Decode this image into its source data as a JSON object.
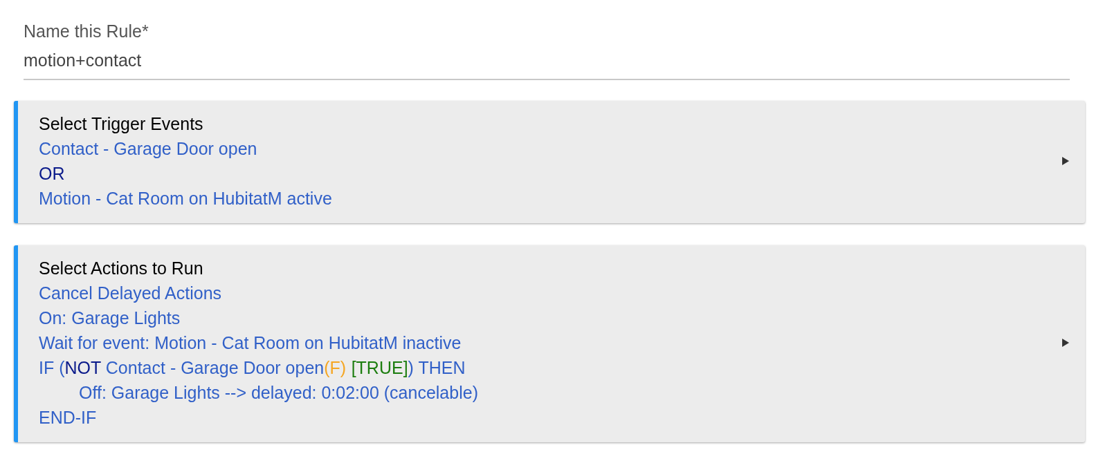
{
  "name_field": {
    "label": "Name this Rule*",
    "value": "motion+contact"
  },
  "sections": [
    {
      "title": "Select Trigger Events",
      "expanded": false,
      "lines": [
        {
          "segments": [
            {
              "kind": "link",
              "text": "Contact - Garage Door open"
            }
          ]
        },
        {
          "segments": [
            {
              "kind": "keyword",
              "text": "OR"
            }
          ]
        },
        {
          "segments": [
            {
              "kind": "link",
              "text": "Motion - Cat Room on HubitatM active"
            }
          ]
        }
      ]
    },
    {
      "title": "Select Actions to Run",
      "expanded": false,
      "lines": [
        {
          "segments": [
            {
              "kind": "link",
              "text": "Cancel Delayed Actions"
            }
          ]
        },
        {
          "segments": [
            {
              "kind": "link",
              "text": "On: Garage Lights"
            }
          ]
        },
        {
          "segments": [
            {
              "kind": "link",
              "text": "Wait for event: Motion - Cat Room on HubitatM inactive"
            }
          ]
        },
        {
          "segments": [
            {
              "kind": "link",
              "text": "IF ("
            },
            {
              "kind": "keyword",
              "text": "NOT"
            },
            {
              "kind": "link",
              "text": " Contact - Garage Door open"
            },
            {
              "kind": "flag",
              "text": "(F)"
            },
            {
              "kind": "state",
              "text": "[TRUE]"
            },
            {
              "kind": "link",
              "text": ") THEN"
            }
          ],
          "children": [
            {
              "segments": [
                {
                  "kind": "link",
                  "text": "Off: Garage Lights --> delayed: 0:02:00 (cancelable)"
                }
              ]
            }
          ]
        },
        {
          "segments": [
            {
              "kind": "link",
              "text": "END-IF"
            }
          ]
        }
      ]
    }
  ]
}
